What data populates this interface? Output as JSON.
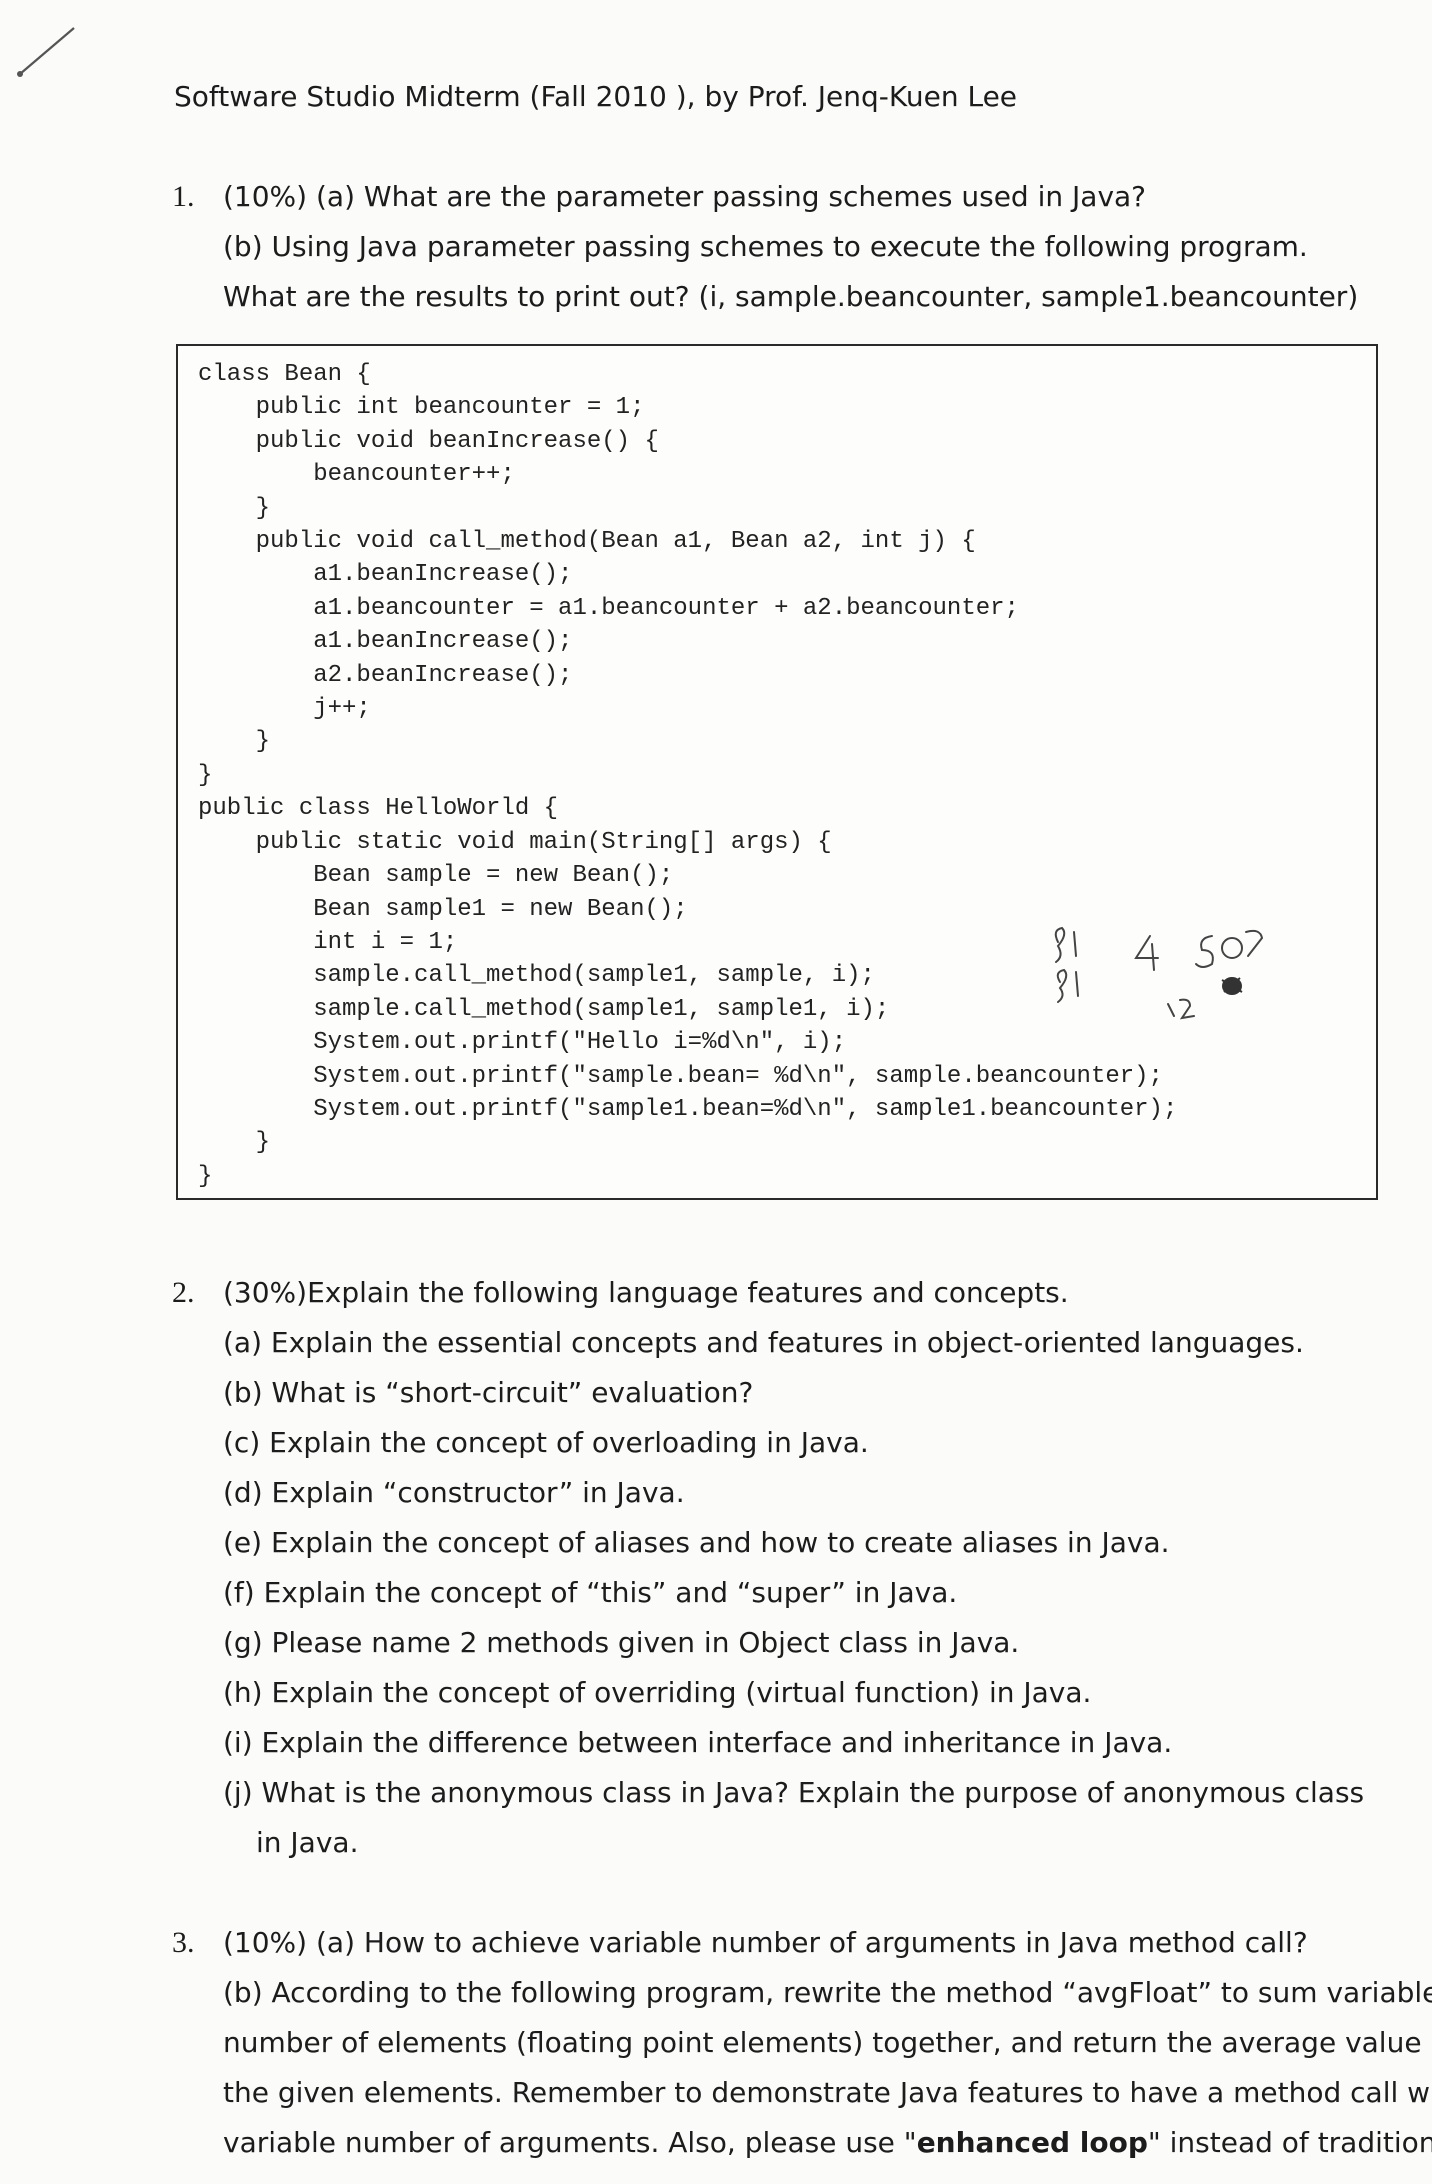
{
  "header": {
    "title": "Software Studio Midterm (Fall 2010 ), by Prof. Jenq-Kuen Lee"
  },
  "q1": {
    "number": "1.",
    "line_a": "(10%) (a) What are the parameter passing schemes used in Java?",
    "line_b": "(b) Using Java parameter passing schemes to execute the following program.",
    "line_c": "What are the results to print out? (i, sample.beancounter, sample1.beancounter)",
    "code": [
      "class Bean {",
      "    public int beancounter = 1;",
      "    public void beanIncrease() {",
      "        beancounter++;",
      "    }",
      "    public void call_method(Bean a1, Bean a2, int j) {",
      "        a1.beanIncrease();",
      "        a1.beancounter = a1.beancounter + a2.beancounter;",
      "        a1.beanIncrease();",
      "        a2.beanIncrease();",
      "        j++;",
      "    }",
      "}",
      "public class HelloWorld {",
      "    public static void main(String[] args) {",
      "        Bean sample = new Bean();",
      "        Bean sample1 = new Bean();",
      "        int i = 1;",
      "        sample.call_method(sample1, sample, i);",
      "        sample.call_method(sample1, sample1, i);",
      "        System.out.printf(\"Hello i=%d\\n\", i);",
      "        System.out.printf(\"sample.bean= %d\\n\", sample.beancounter);",
      "        System.out.printf(\"sample1.bean=%d\\n\", sample1.beancounter);",
      "    }",
      "}"
    ]
  },
  "q2": {
    "number": "2.",
    "title": "(30%)Explain the following language features and concepts.",
    "items": [
      "(a) Explain the essential concepts and features in object-oriented languages.",
      "(b) What is “short-circuit” evaluation?",
      "(c) Explain the concept of overloading in Java.",
      "(d) Explain “constructor” in Java.",
      "(e) Explain the concept of aliases and how to create aliases in Java.",
      "(f) Explain the concept of “this” and “super” in Java.",
      "(g) Please name 2 methods given in Object class in Java.",
      "(h) Explain the concept of overriding (virtual function) in Java.",
      "(i) Explain the difference between interface and inheritance in Java.",
      "(j) What is the anonymous class in Java? Explain the purpose of anonymous class",
      "in Java."
    ]
  },
  "q3": {
    "number": "3.",
    "line_a": "(10%) (a) How to achieve variable number of arguments in Java method call?",
    "line_b": "(b) According to the following program, rewrite the method “avgFloat” to sum variable",
    "line_c": "number of elements (floating point elements) together, and return the average value of",
    "line_d": "the given elements. Remember to demonstrate Java features to have a method call with",
    "line_e_pre": "variable number of arguments. Also, please use \"",
    "line_e_bold": "enhanced loop",
    "line_e_post": "\" instead of traditional"
  }
}
